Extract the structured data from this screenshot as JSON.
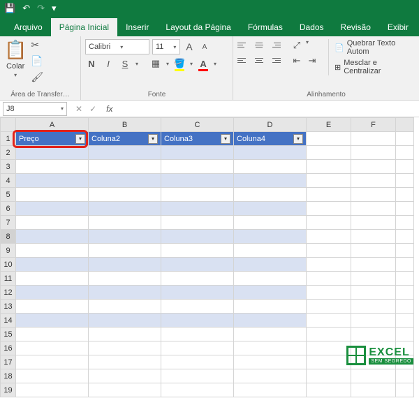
{
  "titlebar": {
    "save": "💾",
    "undo": "↶",
    "redo": "↷",
    "customize": "▾"
  },
  "tabs": {
    "arquivo": "Arquivo",
    "inicial": "Página Inicial",
    "inserir": "Inserir",
    "layout": "Layout da Página",
    "formulas": "Fórmulas",
    "dados": "Dados",
    "revisao": "Revisão",
    "exibir": "Exibir"
  },
  "ribbon": {
    "clipboard": {
      "colar": "Colar",
      "label": "Área de Transfer…"
    },
    "font": {
      "name": "Calibri",
      "size": "11",
      "bold": "N",
      "italic": "I",
      "underline": "S",
      "grow": "A",
      "shrink": "A",
      "label": "Fonte"
    },
    "align": {
      "wrap": "Quebrar Texto Autom",
      "merge": "Mesclar e Centralizar",
      "label": "Alinhamento"
    }
  },
  "namebox": "J8",
  "fx": "fx",
  "columns": [
    "A",
    "B",
    "C",
    "D",
    "E",
    "F",
    ""
  ],
  "table_headers": [
    "Preço",
    "Coluna2",
    "Coluna3",
    "Coluna4"
  ],
  "rows": [
    1,
    2,
    3,
    4,
    5,
    6,
    7,
    8,
    9,
    10,
    11,
    12,
    13,
    14,
    15,
    16,
    17,
    18,
    19
  ],
  "logo": {
    "main": "EXCEL",
    "sub": "SEM SEGREDO"
  }
}
